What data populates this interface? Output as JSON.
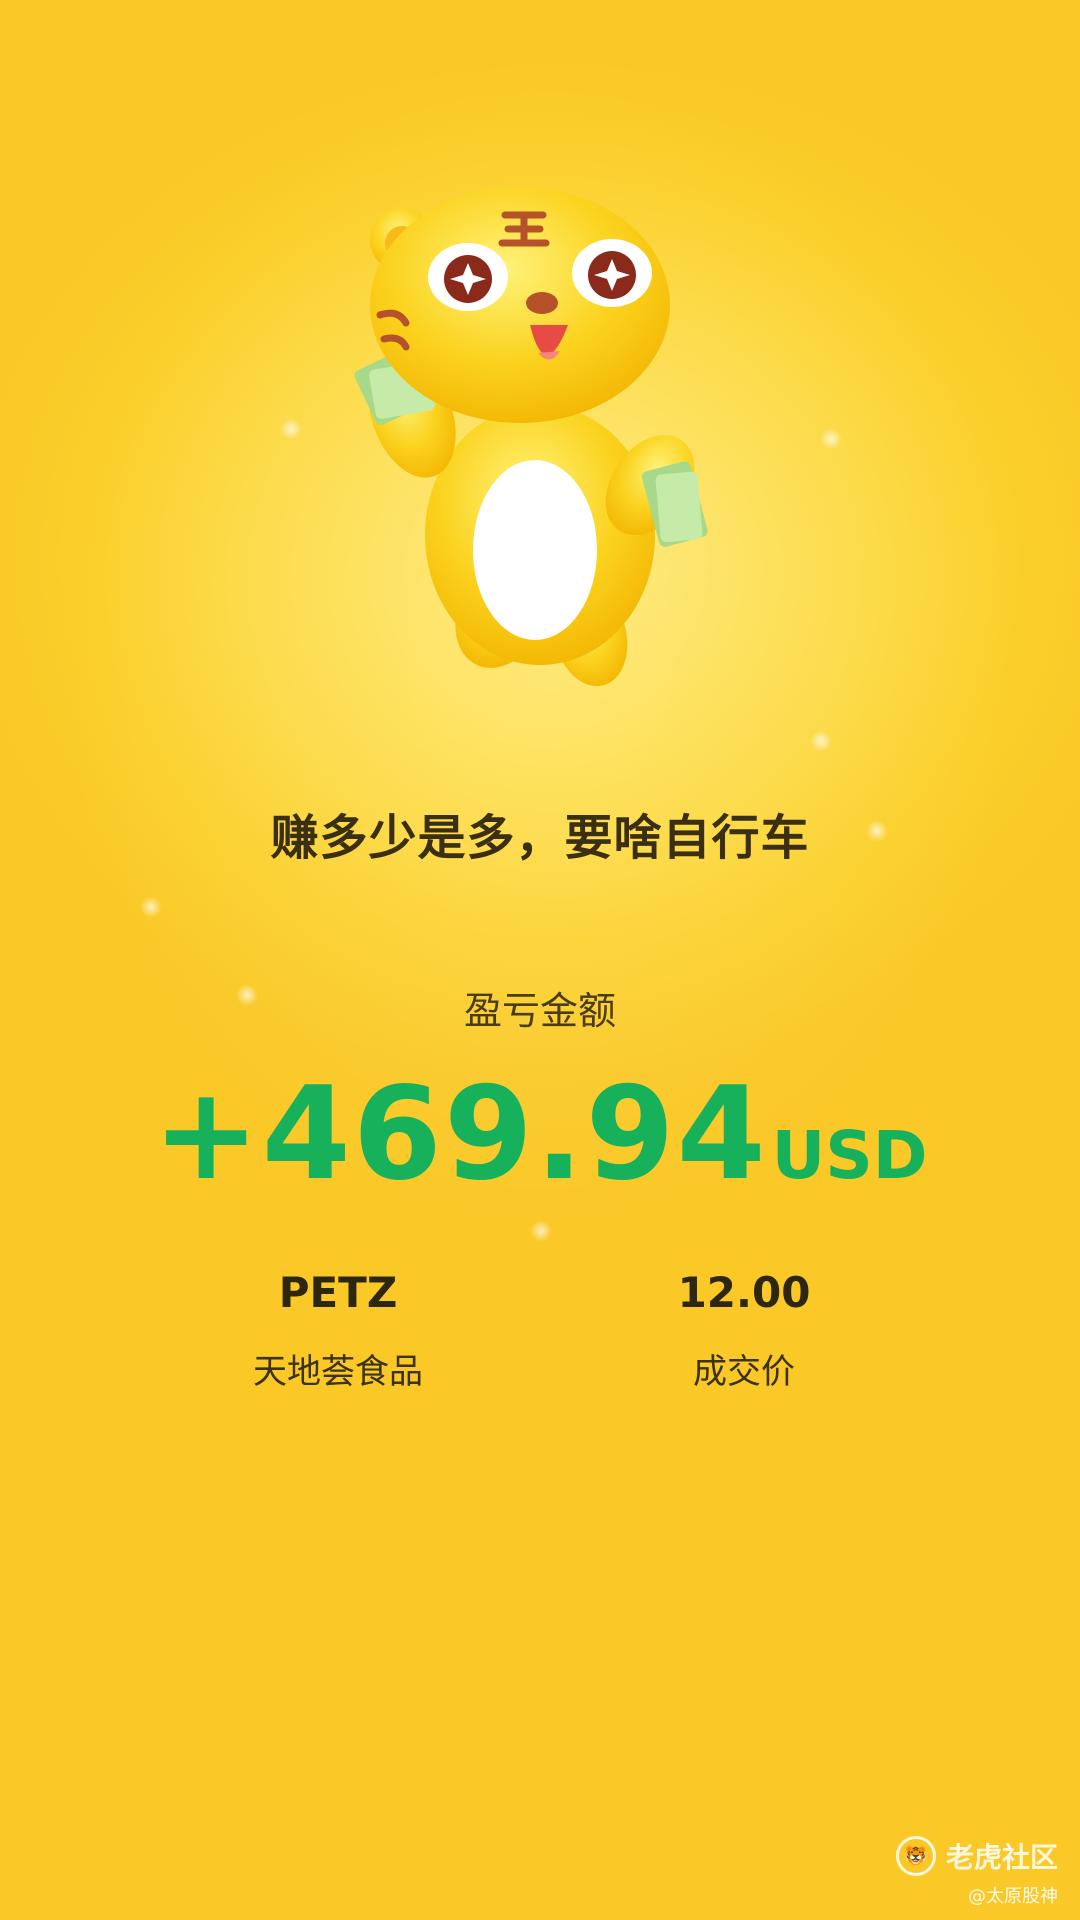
{
  "mascot": {
    "icon": "tiger-mascot-holding-money-icon"
  },
  "slogan": "赚多少是多，要啥自行车",
  "pnl": {
    "label": "盈亏金额",
    "value": "+469.94",
    "unit": "USD",
    "color": "#17b15c"
  },
  "stock": {
    "ticker": "PETZ",
    "name": "天地荟食品"
  },
  "trade": {
    "price": "12.00",
    "price_label": "成交价"
  },
  "watermark": {
    "brand": "老虎社区",
    "user": "@太原股神",
    "icon": "tiger-community-logo-icon"
  },
  "colors": {
    "background": "#fcd232",
    "text_dark": "#2e2710",
    "profit_green": "#17b15c"
  }
}
